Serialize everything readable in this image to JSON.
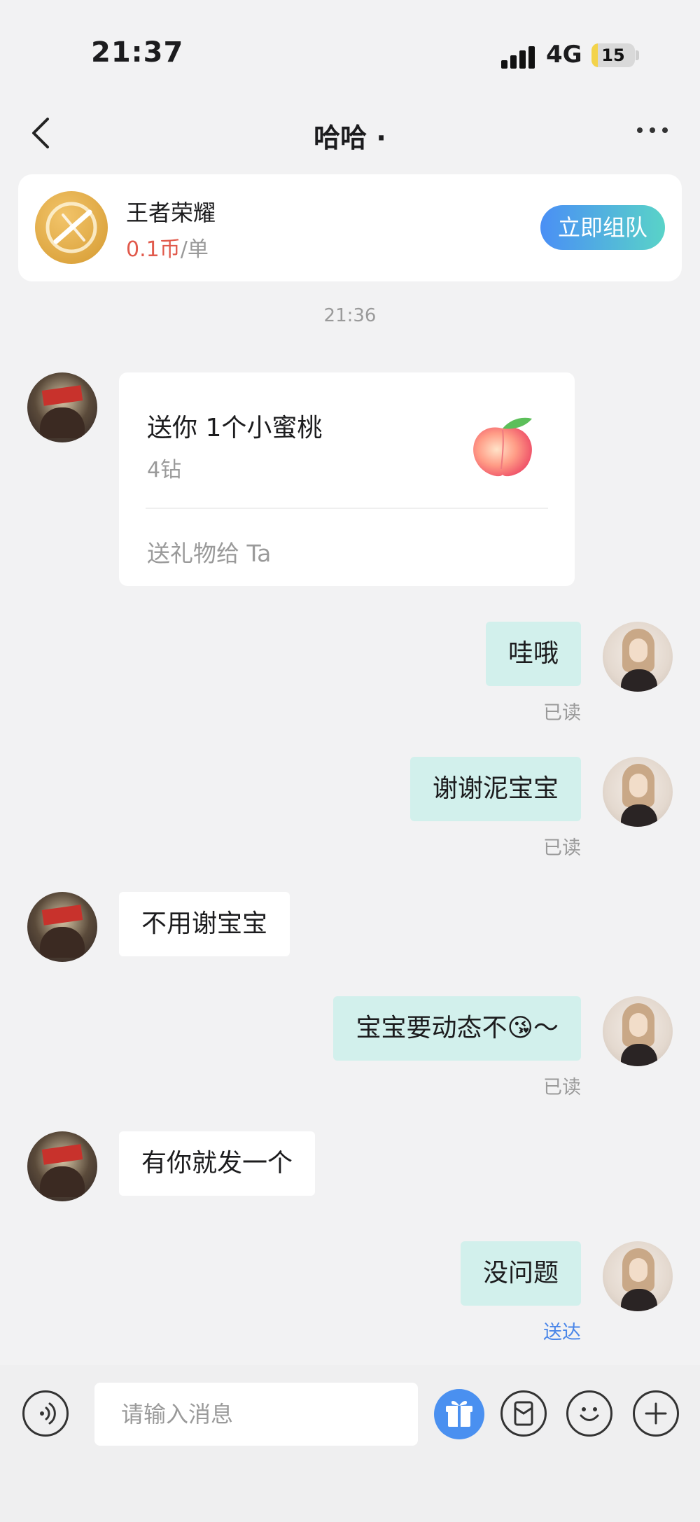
{
  "status_bar": {
    "time": "21:37",
    "network": "4G",
    "battery": "15",
    "battery_level": 0.15
  },
  "nav": {
    "title": "哈哈 ·"
  },
  "game_card": {
    "name": "王者荣耀",
    "price_value": "0.1币",
    "price_unit": "/单",
    "button": "立即组队",
    "logo_text": "王者荣耀"
  },
  "timestamp": "21:36",
  "gift_card": {
    "title": "送你 1个小蜜桃",
    "cost": "4钻",
    "action": "送礼物给 Ta"
  },
  "messages": [
    {
      "sender": "me",
      "text": "哇哦",
      "status": "已读"
    },
    {
      "sender": "me",
      "text": "谢谢泥宝宝",
      "status": "已读"
    },
    {
      "sender": "other",
      "text": "不用谢宝宝"
    },
    {
      "sender": "me",
      "text": "宝宝要动态不😘～",
      "status": "已读"
    },
    {
      "sender": "other",
      "text": "有你就发一个"
    },
    {
      "sender": "me",
      "text": "没问题",
      "status": "送达"
    }
  ],
  "input": {
    "placeholder": "请输入消息"
  },
  "colors": {
    "accent": "#4a90f0",
    "my_bubble": "#d2f0ec",
    "price": "#e15a4c",
    "delivered": "#4a86e8"
  },
  "icons": [
    "voice-icon",
    "gift-icon",
    "red-packet-icon",
    "emoji-icon",
    "plus-icon"
  ]
}
